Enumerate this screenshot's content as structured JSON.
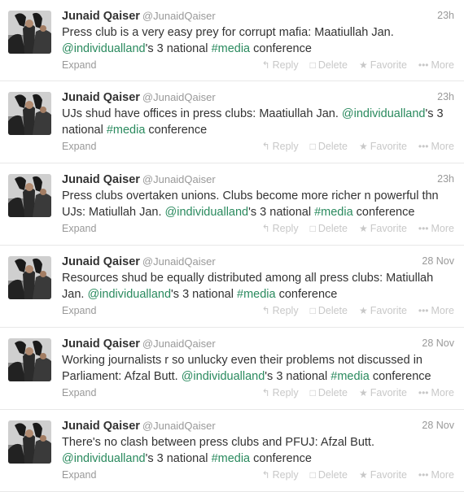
{
  "tweets": [
    {
      "name": "Junaid Qaiser",
      "handle": "@JunaidQaiser",
      "time": "23h",
      "text": [
        {
          "t": "Press club is a very easy prey for corrupt mafia: Maatiullah Jan. "
        },
        {
          "t": "@individualland",
          "link": true
        },
        {
          "t": "'s 3 national "
        },
        {
          "t": "#media",
          "link": true
        },
        {
          "t": " conference"
        }
      ]
    },
    {
      "name": "Junaid Qaiser",
      "handle": "@JunaidQaiser",
      "time": "23h",
      "text": [
        {
          "t": "UJs shud have offices in press clubs: Maatiullah Jan. "
        },
        {
          "t": "@individualland",
          "link": true
        },
        {
          "t": "'s 3 national "
        },
        {
          "t": "#media",
          "link": true
        },
        {
          "t": " conference"
        }
      ]
    },
    {
      "name": "Junaid Qaiser",
      "handle": "@JunaidQaiser",
      "time": "23h",
      "text": [
        {
          "t": "Press clubs overtaken unions. Clubs become more richer n powerful thn UJs:  Matiullah Jan. "
        },
        {
          "t": "@individualland",
          "link": true
        },
        {
          "t": "'s 3 national "
        },
        {
          "t": "#media",
          "link": true
        },
        {
          "t": " conference"
        }
      ]
    },
    {
      "name": "Junaid Qaiser",
      "handle": "@JunaidQaiser",
      "time": "28 Nov",
      "text": [
        {
          "t": "Resources shud be equally distributed among all press clubs: Matiullah Jan. "
        },
        {
          "t": "@individualland",
          "link": true
        },
        {
          "t": "'s 3 national "
        },
        {
          "t": "#media",
          "link": true
        },
        {
          "t": " conference"
        }
      ]
    },
    {
      "name": "Junaid Qaiser",
      "handle": "@JunaidQaiser",
      "time": "28 Nov",
      "text": [
        {
          "t": "Working journalists r so unlucky even their problems not discussed in Parliament: Afzal Butt. "
        },
        {
          "t": "@individualland",
          "link": true
        },
        {
          "t": "'s 3 national "
        },
        {
          "t": "#media",
          "link": true
        },
        {
          "t": " conference"
        }
      ]
    },
    {
      "name": "Junaid Qaiser",
      "handle": "@JunaidQaiser",
      "time": "28 Nov",
      "text": [
        {
          "t": "There's no clash between press clubs and PFUJ: Afzal Butt. "
        },
        {
          "t": "@individualland",
          "link": true
        },
        {
          "t": "'s 3 national "
        },
        {
          "t": "#media",
          "link": true
        },
        {
          "t": " conference"
        }
      ]
    }
  ],
  "labels": {
    "expand": "Expand",
    "reply": "Reply",
    "delete": "Delete",
    "favorite": "Favorite",
    "more": "More"
  },
  "icons": {
    "reply": "reply-arrow-icon",
    "delete": "trash-icon",
    "favorite": "star-icon",
    "more": "ellipsis-icon"
  },
  "colors": {
    "link": "#2a8a5e",
    "muted": "#999999",
    "action": "#c8c8c8",
    "text": "#333333"
  }
}
